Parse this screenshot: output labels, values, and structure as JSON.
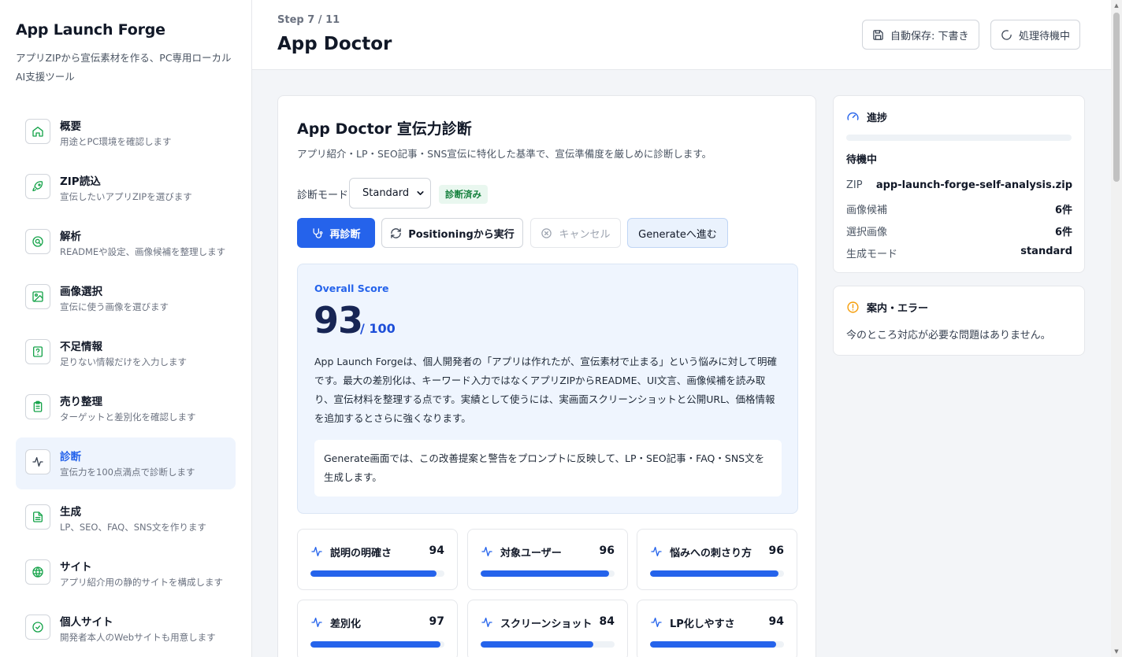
{
  "brand": {
    "title": "App Launch Forge",
    "subtitle": "アプリZIPから宣伝素材を作る、PC専用ローカルAI支援ツール"
  },
  "nav": [
    {
      "label": "概要",
      "desc": "用途とPC環境を確認します",
      "icon": "home-icon"
    },
    {
      "label": "ZIP読込",
      "desc": "宣伝したいアプリZIPを選びます",
      "icon": "rocket-icon"
    },
    {
      "label": "解析",
      "desc": "READMEや設定、画像候補を整理します",
      "icon": "search-icon"
    },
    {
      "label": "画像選択",
      "desc": "宣伝に使う画像を選びます",
      "icon": "image-icon"
    },
    {
      "label": "不足情報",
      "desc": "足りない情報だけを入力します",
      "icon": "question-icon"
    },
    {
      "label": "売り整理",
      "desc": "ターゲットと差別化を確認します",
      "icon": "clipboard-icon"
    },
    {
      "label": "診断",
      "desc": "宣伝力を100点満点で診断します",
      "icon": "activity-icon",
      "active": true
    },
    {
      "label": "生成",
      "desc": "LP、SEO、FAQ、SNS文を作ります",
      "icon": "document-icon"
    },
    {
      "label": "サイト",
      "desc": "アプリ紹介用の静的サイトを構成します",
      "icon": "globe-icon"
    },
    {
      "label": "個人サイト",
      "desc": "開発者本人のWebサイトも用意します",
      "icon": "compass-icon"
    }
  ],
  "header": {
    "step": "Step 7 / 11",
    "title": "App Doctor",
    "autosave_label": "自動保存: 下書き",
    "status_label": "処理待機中"
  },
  "doctor": {
    "title": "App Doctor 宣伝力診断",
    "description": "アプリ紹介・LP・SEO記事・SNS宣伝に特化した基準で、宣伝準備度を厳しめに診断します。",
    "mode_label": "診断モード",
    "mode_value": "Standard",
    "badge": "診断済み",
    "buttons": {
      "rediagnose": "再診断",
      "from_positioning": "Positioningから実行",
      "cancel": "キャンセル",
      "to_generate": "Generateへ進む"
    },
    "overall_label": "Overall Score",
    "score": "93",
    "score_max": "/ 100",
    "summary": "App Launch Forgeは、個人開発者の「アプリは作れたが、宣伝素材で止まる」という悩みに対して明確です。最大の差別化は、キーワード入力ではなくアプリZIPからREADME、UI文言、画像候補を読み取り、宣伝材料を整理する点です。実績として使うには、実画面スクリーンショットと公開URL、価格情報を追加するとさらに強くなります。",
    "note": "Generate画面では、この改善提案と警告をプロンプトに反映して、LP・SEO記事・FAQ・SNS文を生成します。",
    "metrics": [
      {
        "name": "説明の明確さ",
        "score": 94
      },
      {
        "name": "対象ユーザー",
        "score": 96
      },
      {
        "name": "悩みへの刺さり方",
        "score": 96
      },
      {
        "name": "差別化",
        "score": 97
      },
      {
        "name": "スクリーンショット",
        "score": 84
      },
      {
        "name": "LP化しやすさ",
        "score": 94
      }
    ]
  },
  "progress": {
    "title": "進捗",
    "status": "待機中",
    "fraction": 0,
    "rows": [
      {
        "key": "ZIP",
        "value": "app-launch-forge-self-analysis.zip"
      },
      {
        "key": "画像候補",
        "value": "6件"
      },
      {
        "key": "選択画像",
        "value": "6件"
      },
      {
        "key": "生成モード",
        "value": "standard"
      }
    ]
  },
  "info": {
    "title": "案内・エラー",
    "message": "今のところ対応が必要な問題はありません。"
  },
  "colors": {
    "accent": "#2563eb",
    "success": "#15803d",
    "warning": "#f59e0b",
    "nav_icon": "#16a34a"
  }
}
